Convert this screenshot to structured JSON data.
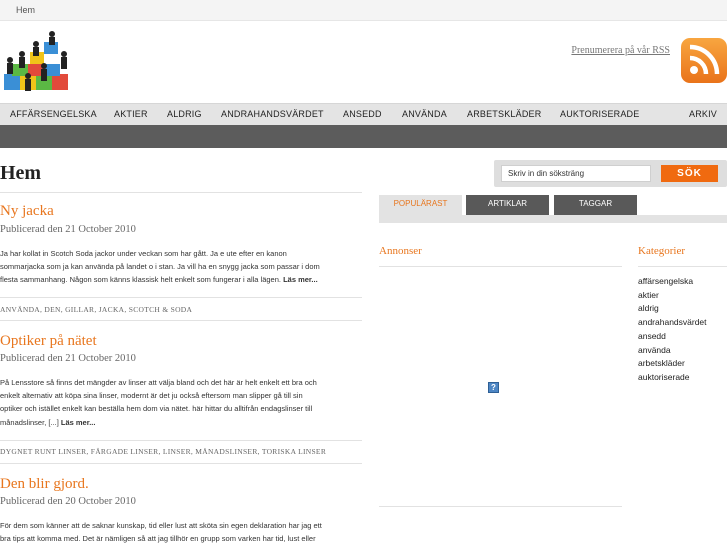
{
  "breadcrumb": "Hem",
  "rss": {
    "link_text": "Prenumerera på vår RSS",
    "icon": "rss-icon"
  },
  "logo": {
    "icon": "people-puzzle-logo"
  },
  "nav": {
    "items": [
      "AFFÄRSENGELSKA",
      "AKTIER",
      "ALDRIG",
      "ANDRAHANDSVÄRDET",
      "ANSEDD",
      "ANVÄNDA",
      "ARBETSKLÄDER",
      "AUKTORISERADE"
    ],
    "archive": "ARKIV"
  },
  "page": {
    "title": "Hem"
  },
  "posts": [
    {
      "title": "Ny jacka",
      "date": "Publicerad den 21 October 2010",
      "lines": [
        "Ja har kollat in Scotch Soda jackor under veckan som har gått. Ja e ute efter en kanon",
        "sommarjacka som ja kan använda på landet o i stan. Ja vill ha en snygg jacka som passar i dom",
        "flesta sammanhang. Någon som känns klassisk helt enkelt som fungerar i alla lägen."
      ],
      "read_more": "Läs mer...",
      "tags": [
        "ANVÄNDA",
        "DEN",
        "GILLAR",
        "JACKA",
        "SCOTCH & SODA"
      ]
    },
    {
      "title": "Optiker på nätet",
      "date": "Publicerad den 21 October 2010",
      "lines": [
        "På Lensstore så finns det mängder av linser att välja bland och det här är helt enkelt ett bra och",
        "enkelt alternativ att köpa sina linser, modernt är det ju också eftersom man slipper gå till sin",
        "optiker och istället enkelt kan beställa hem dom via nätet. här hittar du alltifrån endagslinser till",
        "månadslinser, [...]"
      ],
      "read_more": "Läs mer...",
      "tags": [
        "DYGNET RUNT LINSER",
        "FÄRGADE LINSER",
        "LINSER",
        "MÅNADSLINSER",
        "TORISKA LINSER"
      ]
    },
    {
      "title": "Den blir gjord.",
      "date": "Publicerad den 20 October 2010",
      "lines": [
        "För dem som känner att de saknar kunskap, tid eller lust att sköta sin egen deklaration har jag ett",
        "bra tips att komma med. Det är nämligen så att jag tillhör en grupp som varken har tid, lust eller"
      ],
      "read_more": "",
      "tags": []
    }
  ],
  "search": {
    "placeholder": "Skriv in din söksträng",
    "value": "Skriv in din söksträng",
    "button": "SÖK"
  },
  "tabs": [
    {
      "label": "POPULÄRAST",
      "active": true
    },
    {
      "label": "ARTIKLAR",
      "active": false
    },
    {
      "label": "TAGGAR",
      "active": false
    }
  ],
  "ads": {
    "heading": "Annonser",
    "icon": "broken-image-icon"
  },
  "categories": {
    "heading": "Kategorier",
    "items": [
      "affärsengelska",
      "aktier",
      "aldrig",
      "andrahandsvärdet",
      "ansedd",
      "använda",
      "arbetskläder",
      "auktoriserade"
    ]
  },
  "colors": {
    "accent": "#e8761e",
    "search_button": "#f06a10",
    "dark_bar": "#5c5c5c",
    "nav_bar": "#e4e4e4"
  }
}
